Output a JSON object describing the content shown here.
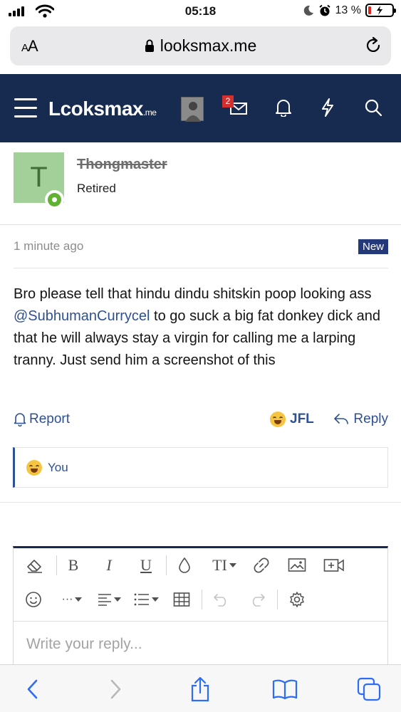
{
  "status_bar": {
    "time": "05:18",
    "battery_percent": "13 %",
    "battery_level": 0.13
  },
  "browser": {
    "text_size_label": "AA",
    "url": "looksmax.me"
  },
  "site_header": {
    "logo_text": "Lcoksmax",
    "logo_tld": ".me",
    "notification_badge": "2",
    "colors": {
      "header_bg": "#172a4f",
      "badge": "#d32f2f"
    }
  },
  "user": {
    "avatar_letter": "T",
    "name": "Thongmaster",
    "title": "Retired",
    "avatar_color": "#a3cf99",
    "online": true
  },
  "post": {
    "time": "1 minute ago",
    "badge": "New",
    "body_before": "Bro please tell that hindu dindu shitskin poop looking ass ",
    "mention": "@SubhumanCurrycel",
    "body_after": " to go suck a big fat donkey dick and that he will always stay a virgin for calling me a larping tranny. Just send him a screenshot of this",
    "actions": {
      "report": "Report",
      "reaction": "JFL",
      "reply": "Reply"
    },
    "reactions_summary": "You"
  },
  "editor": {
    "placeholder": "Write your reply...",
    "toolbar": {
      "bold": "B",
      "italic": "I",
      "underline": "U",
      "font_size": "TI",
      "more": "···"
    }
  }
}
